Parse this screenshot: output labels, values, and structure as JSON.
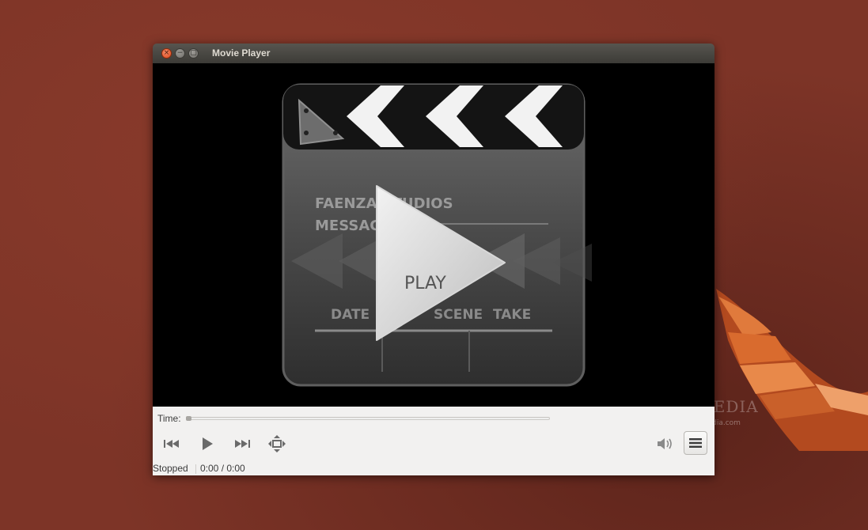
{
  "window": {
    "title": "Movie Player",
    "close_glyph": "×",
    "minimize_glyph": "−",
    "maximize_glyph": "▢"
  },
  "video": {
    "clapper_line1": "FAENZA STUDIOS",
    "clapper_line2": "MESSAGE",
    "clapper_date": "DATE",
    "clapper_scene": "SCENE",
    "clapper_take": "TAKE",
    "play_label": "PLAY"
  },
  "controls": {
    "time_label": "Time:",
    "seek_position": 0,
    "previous_icon": "skip-back-icon",
    "play_icon": "play-icon",
    "next_icon": "skip-forward-icon",
    "fullscreen_icon": "fullscreen-icon",
    "volume_icon": "speaker-icon",
    "menu_icon": "hamburger-menu-icon"
  },
  "status": {
    "state": "Stopped",
    "time": "0:00 / 0:00"
  },
  "watermark": {
    "text": "SOFTPEDIA",
    "sub": "www.softpedia.com"
  },
  "colors": {
    "desktop": "#7d3427",
    "titlebar": "#3c3b37",
    "close_button": "#df4a1c",
    "controls_bg": "#f2f1f0"
  }
}
